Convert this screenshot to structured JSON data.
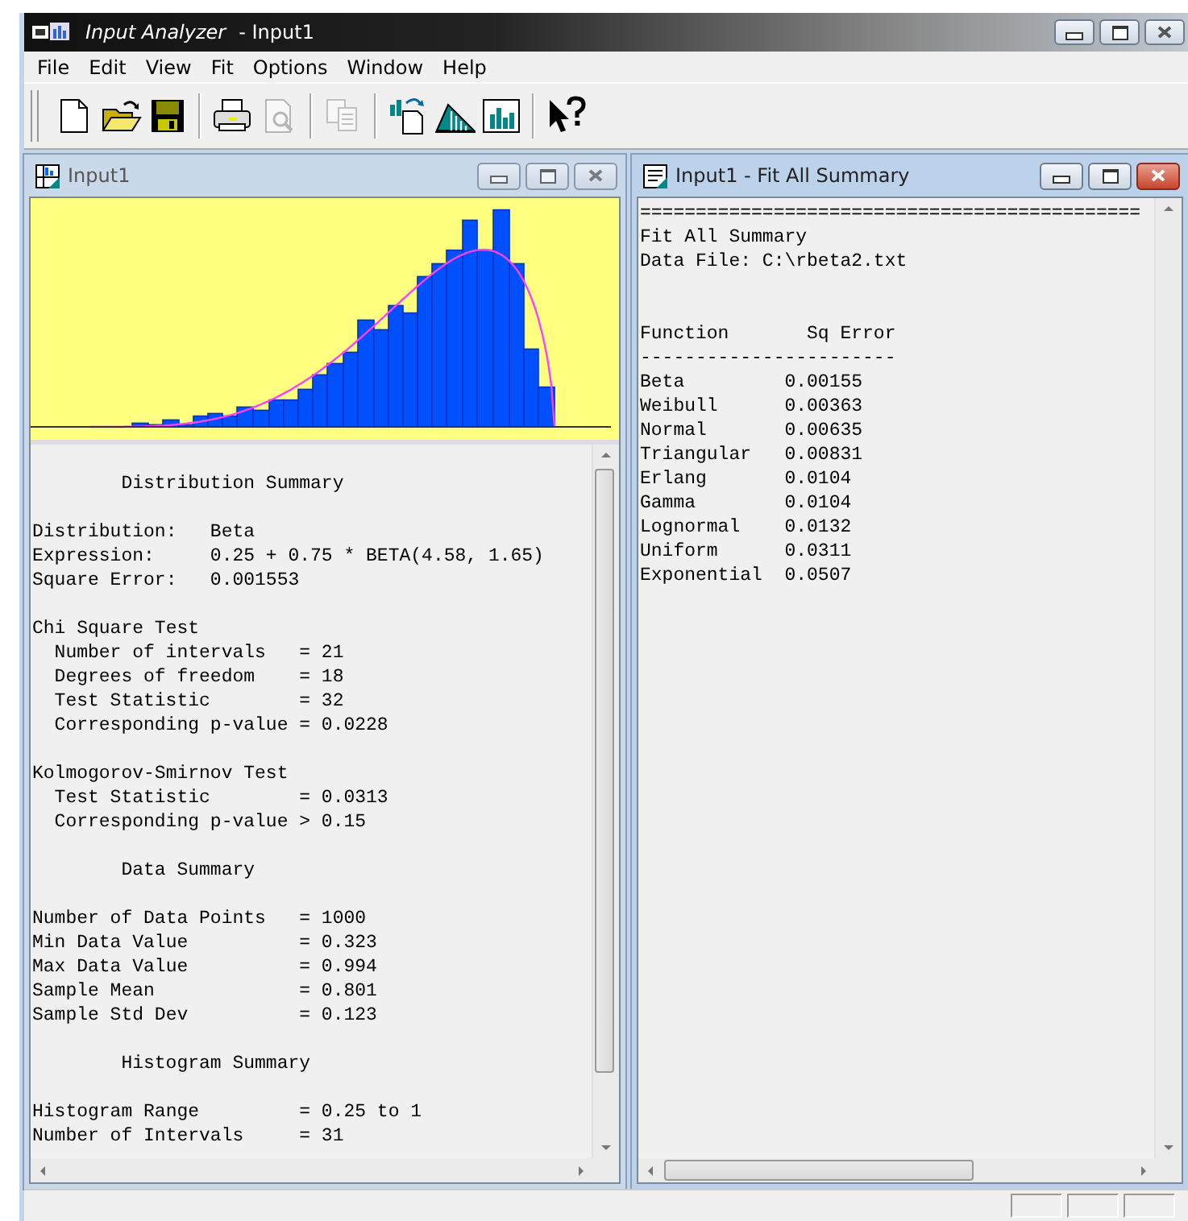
{
  "app": {
    "title": "Input Analyzer",
    "document": "- Input1"
  },
  "menu": [
    "File",
    "Edit",
    "View",
    "Fit",
    "Options",
    "Window",
    "Help"
  ],
  "toolbar": [
    [
      {
        "kind": "new",
        "disabled": false
      },
      {
        "kind": "open",
        "disabled": false
      },
      {
        "kind": "save",
        "disabled": false
      }
    ],
    [
      {
        "kind": "print",
        "disabled": false
      },
      {
        "kind": "preview",
        "disabled": true
      }
    ],
    [
      {
        "kind": "copy",
        "disabled": true
      }
    ],
    [
      {
        "kind": "fit",
        "disabled": false
      },
      {
        "kind": "triangle",
        "disabled": false
      },
      {
        "kind": "histogram",
        "disabled": false
      }
    ],
    [
      {
        "kind": "help",
        "disabled": false
      }
    ]
  ],
  "windows": [
    {
      "kind": "histogram",
      "title": "Input1",
      "active": false,
      "lines": [
        {
          "kind": "blank"
        },
        {
          "kind": "heading",
          "text": "Distribution Summary"
        },
        {
          "kind": "blank"
        },
        {
          "kind": "line",
          "text": "Distribution:   Beta"
        },
        {
          "kind": "line",
          "text": "Expression:     0.25 + 0.75 * BETA(4.58, 1.65)"
        },
        {
          "kind": "line",
          "text": "Square Error:   0.001553"
        },
        {
          "kind": "blank"
        },
        {
          "kind": "line",
          "text": "Chi Square Test"
        },
        {
          "kind": "item",
          "text": "Number of intervals   = 21"
        },
        {
          "kind": "item",
          "text": "Degrees of freedom    = 18"
        },
        {
          "kind": "item",
          "text": "Test Statistic        = 32"
        },
        {
          "kind": "item",
          "text": "Corresponding p-value = 0.0228"
        },
        {
          "kind": "blank"
        },
        {
          "kind": "line",
          "text": "Kolmogorov-Smirnov Test"
        },
        {
          "kind": "item",
          "text": "Test Statistic        = 0.0313"
        },
        {
          "kind": "item",
          "text": "Corresponding p-value > 0.15"
        },
        {
          "kind": "blank"
        },
        {
          "kind": "heading",
          "text": "Data Summary"
        },
        {
          "kind": "blank"
        },
        {
          "kind": "line",
          "text": "Number of Data Points   = 1000"
        },
        {
          "kind": "line",
          "text": "Min Data Value          = 0.323"
        },
        {
          "kind": "line",
          "text": "Max Data Value          = 0.994"
        },
        {
          "kind": "line",
          "text": "Sample Mean             = 0.801"
        },
        {
          "kind": "line",
          "text": "Sample Std Dev          = 0.123"
        },
        {
          "kind": "blank"
        },
        {
          "kind": "heading",
          "text": "Histogram Summary"
        },
        {
          "kind": "blank"
        },
        {
          "kind": "line",
          "text": "Histogram Range         = 0.25 to 1"
        },
        {
          "kind": "line",
          "text": "Number of Intervals     = 31"
        }
      ]
    },
    {
      "kind": "summary",
      "title": "Input1 - Fit All Summary",
      "active": true,
      "lines": [
        {
          "kind": "line",
          "text": "============================================="
        },
        {
          "kind": "line",
          "text": "Fit All Summary"
        },
        {
          "kind": "line",
          "text": "Data File: C:\\rbeta2.txt"
        },
        {
          "kind": "blank"
        },
        {
          "kind": "blank"
        },
        {
          "kind": "line",
          "text": "Function       Sq Error"
        },
        {
          "kind": "line",
          "text": "-----------------------"
        },
        {
          "kind": "line",
          "text": "Beta         0.00155"
        },
        {
          "kind": "line",
          "text": "Weibull      0.00363"
        },
        {
          "kind": "line",
          "text": "Normal       0.00635"
        },
        {
          "kind": "line",
          "text": "Triangular   0.00831"
        },
        {
          "kind": "line",
          "text": "Erlang       0.0104"
        },
        {
          "kind": "line",
          "text": "Gamma        0.0104"
        },
        {
          "kind": "line",
          "text": "Lognormal    0.0132"
        },
        {
          "kind": "line",
          "text": "Uniform      0.0311"
        },
        {
          "kind": "line",
          "text": "Exponential  0.0507"
        }
      ]
    }
  ]
}
